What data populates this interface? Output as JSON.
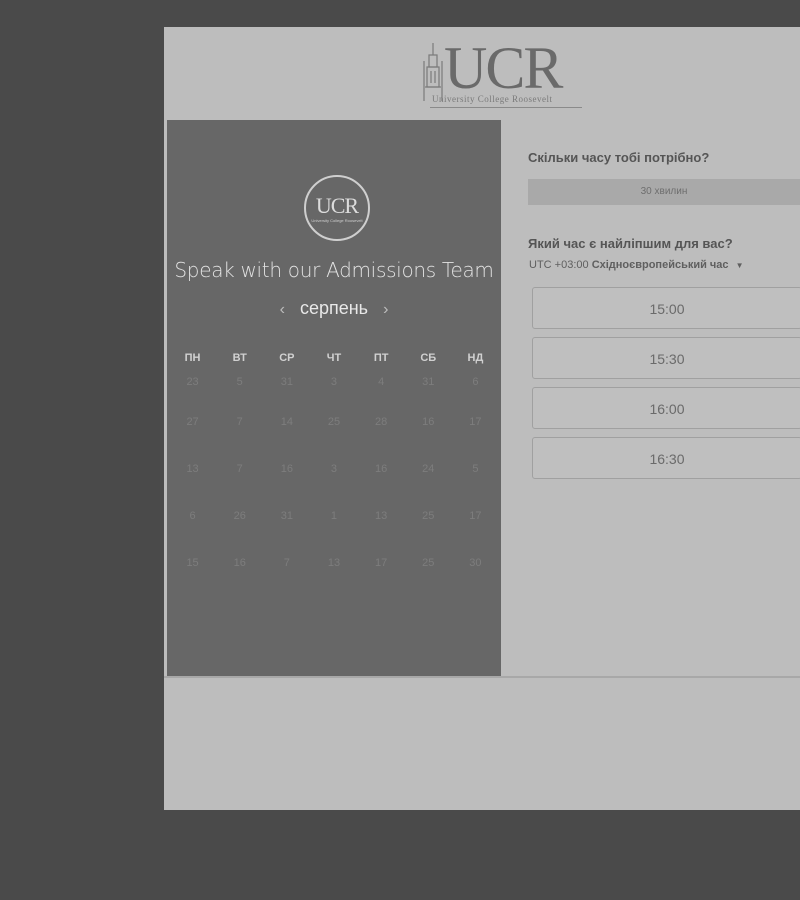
{
  "header": {
    "logo_word": "UCR",
    "logo_subtitle": "University College Roosevelt"
  },
  "left": {
    "badge_word": "UCR",
    "badge_sub": "University College Roosevelt",
    "title": "Speak with our Admissions Team",
    "month": "серпень",
    "prev_icon": "‹",
    "next_icon": "›",
    "weekdays": [
      "ПН",
      "ВТ",
      "СР",
      "ЧТ",
      "ПТ",
      "СБ",
      "НД"
    ],
    "weeks": [
      [
        "23",
        "5",
        "31",
        "3",
        "4",
        "31",
        "6"
      ],
      [
        "27",
        "7",
        "14",
        "25",
        "28",
        "16",
        "17"
      ],
      [
        "13",
        "7",
        "16",
        "3",
        "16",
        "24",
        "5"
      ],
      [
        "6",
        "26",
        "31",
        "1",
        "13",
        "25",
        "17"
      ],
      [
        "15",
        "16",
        "7",
        "13",
        "17",
        "25",
        "30"
      ]
    ]
  },
  "right": {
    "duration_question": "Скільки часу тобі потрібно?",
    "duration_value": "30 хвилин",
    "time_question": "Який час є найліпшим для вас?",
    "timezone_offset": "UTC +03:00",
    "timezone_name": "Східноєвропейський час",
    "slots": [
      "15:00",
      "15:30",
      "16:00",
      "16:30"
    ]
  },
  "colors": {
    "overlay": "#4a4a4a",
    "panel": "#bdbdbd",
    "left_panel": "#676767"
  }
}
